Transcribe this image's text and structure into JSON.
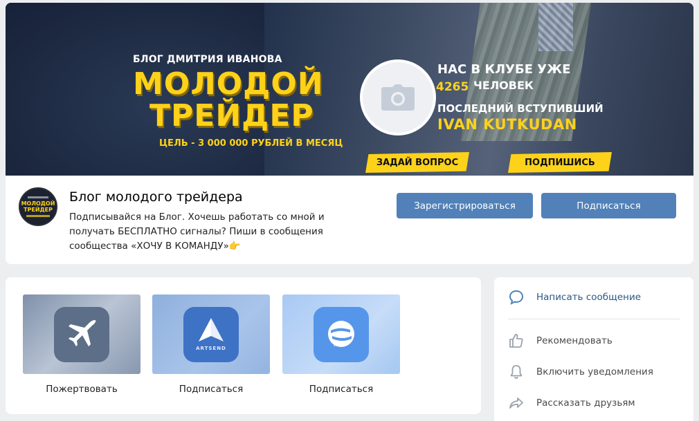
{
  "cover": {
    "eyebrow": "БЛОГ ДМИТРИЯ ИВАНОВА",
    "title_line1": "МОЛОДОЙ",
    "title_line2": "ТРЕЙДЕР",
    "goal": "ЦЕЛЬ - 3 000 000 РУБЛЕЙ В МЕСЯЦ",
    "club_line1": "НАС В КЛУБЕ УЖЕ",
    "club_count": "4265",
    "club_people": "ЧЕЛОВЕК",
    "last_joined_label": "ПОСЛЕДНИЙ ВСТУПИВШИЙ",
    "last_joined_name": "IVAN KUTKUDAN",
    "ask_button": "ЗАДАЙ ВОПРОС",
    "subscribe_cta": "ПОДПИШИСЬ"
  },
  "group": {
    "name": "Блог молодого трейдера",
    "status": "Подписывайся на Блог. Хочешь работать со мной и получать БЕСПЛАТНО сигналы? Пиши в сообщения сообщества «ХОЧУ В КОМАНДУ»👉",
    "avatar_text_line1": "МОЛОДОЙ",
    "avatar_text_line2": "ТРЕЙДЕР"
  },
  "buttons": {
    "register": "Зарегистрироваться",
    "subscribe": "Подписаться"
  },
  "apps": [
    {
      "label": "Пожертвовать",
      "icon": "airplane-icon"
    },
    {
      "label": "Подписаться",
      "icon": "paper-plane-icon",
      "caption": "ARTSEND"
    },
    {
      "label": "Подписаться",
      "icon": "chat-bubble-s-icon"
    }
  ],
  "actions": {
    "message": "Написать сообщение",
    "recommend": "Рекомендовать",
    "notifications": "Включить уведомления",
    "share": "Рассказать друзьям"
  },
  "colors": {
    "vk_blue": "#5181b8",
    "cover_accent": "#ffd21a",
    "link": "#2a5885",
    "page_bg": "#edeef0"
  }
}
